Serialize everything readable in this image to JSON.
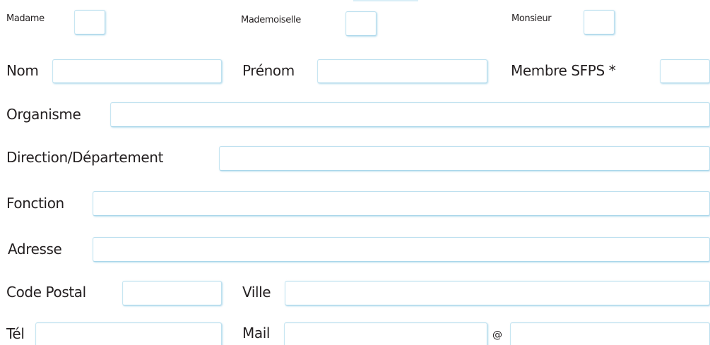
{
  "civility": {
    "madame_label": "Madame",
    "mademoiselle_label": "Mademoiselle",
    "monsieur_label": "Monsieur"
  },
  "fields": {
    "nom_label": "Nom",
    "prenom_label": "Prénom",
    "membre_sfps_label": "Membre SFPS *",
    "organisme_label": "Organisme",
    "direction_label": "Direction/Département",
    "fonction_label": "Fonction",
    "adresse_label": "Adresse",
    "code_postal_label": "Code Postal",
    "ville_label": "Ville",
    "tel_label": "Tél",
    "mail_label": "Mail",
    "mail_separator": "@"
  },
  "values": {
    "nom": "",
    "prenom": "",
    "membre_sfps": "",
    "organisme": "",
    "direction": "",
    "fonction": "",
    "adresse": "",
    "code_postal": "",
    "ville": "",
    "tel": "",
    "mail_user": "",
    "mail_domain": ""
  },
  "colors": {
    "field_border": "#bde0ef",
    "label_text": "#231f20"
  }
}
